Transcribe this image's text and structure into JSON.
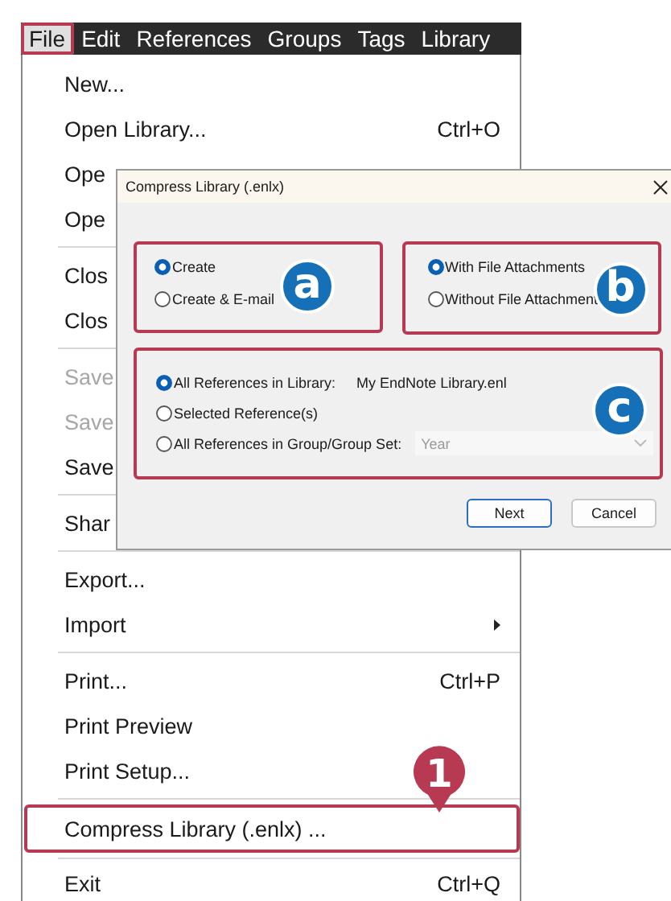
{
  "menu_bar": [
    {
      "label": "File",
      "selected": true,
      "outlined": true
    },
    {
      "label": "Edit",
      "selected": false,
      "outlined": false
    },
    {
      "label": "References",
      "selected": false,
      "outlined": false
    },
    {
      "label": "Groups",
      "selected": false,
      "outlined": false
    },
    {
      "label": "Tags",
      "selected": false,
      "outlined": false
    },
    {
      "label": "Library",
      "selected": false,
      "outlined": false
    }
  ],
  "file_menu": {
    "items": [
      {
        "kind": "item",
        "label": "New...",
        "disabled": false
      },
      {
        "kind": "item",
        "label": "Open Library...",
        "shortcut": "Ctrl+O",
        "disabled": false
      },
      {
        "kind": "item",
        "label": "Ope",
        "disabled": false
      },
      {
        "kind": "item",
        "label": "Ope",
        "disabled": false
      },
      {
        "kind": "separator"
      },
      {
        "kind": "item",
        "label": "Clos",
        "disabled": false
      },
      {
        "kind": "item",
        "label": "Clos",
        "disabled": false
      },
      {
        "kind": "separator"
      },
      {
        "kind": "item",
        "label": "Save",
        "disabled": true
      },
      {
        "kind": "item",
        "label": "Save",
        "disabled": true
      },
      {
        "kind": "item",
        "label": "Save",
        "disabled": false
      },
      {
        "kind": "separator"
      },
      {
        "kind": "item",
        "label": "Shar",
        "disabled": false
      },
      {
        "kind": "separator"
      },
      {
        "kind": "item",
        "label": "Export...",
        "disabled": false
      },
      {
        "kind": "item",
        "label": "Import",
        "disabled": false,
        "submenu": true
      },
      {
        "kind": "separator"
      },
      {
        "kind": "item",
        "label": "Print...",
        "shortcut": "Ctrl+P",
        "disabled": false
      },
      {
        "kind": "item",
        "label": "Print Preview",
        "disabled": false
      },
      {
        "kind": "item",
        "label": "Print Setup...",
        "disabled": false
      },
      {
        "kind": "separator"
      },
      {
        "kind": "item",
        "label": "Compress Library (.enlx) ...",
        "disabled": false,
        "outlined": true,
        "badge": "1"
      },
      {
        "kind": "separator"
      },
      {
        "kind": "item",
        "label": "Exit",
        "shortcut": "Ctrl+Q",
        "disabled": false
      }
    ]
  },
  "dialog": {
    "title": "Compress Library (.enlx)",
    "groups": [
      {
        "badge": "a",
        "options": [
          {
            "label": "Create",
            "selected": true
          },
          {
            "label": "Create & E-mail",
            "selected": false
          }
        ]
      },
      {
        "badge": "b",
        "options": [
          {
            "label": "With File Attachments",
            "selected": true
          },
          {
            "label": "Without File Attachment",
            "selected": false
          }
        ]
      },
      {
        "badge": "c",
        "options": [
          {
            "label": "All References in Library:",
            "selected": true,
            "value": "My EndNote Library.enl"
          },
          {
            "label": "Selected Reference(s)",
            "selected": false
          },
          {
            "label": "All References in Group/Group Set:",
            "selected": false,
            "dropdown": {
              "value": "Year",
              "disabled": true
            }
          }
        ]
      }
    ],
    "buttons": [
      {
        "label": "Next",
        "default": true
      },
      {
        "label": "Cancel",
        "default": false
      }
    ]
  }
}
